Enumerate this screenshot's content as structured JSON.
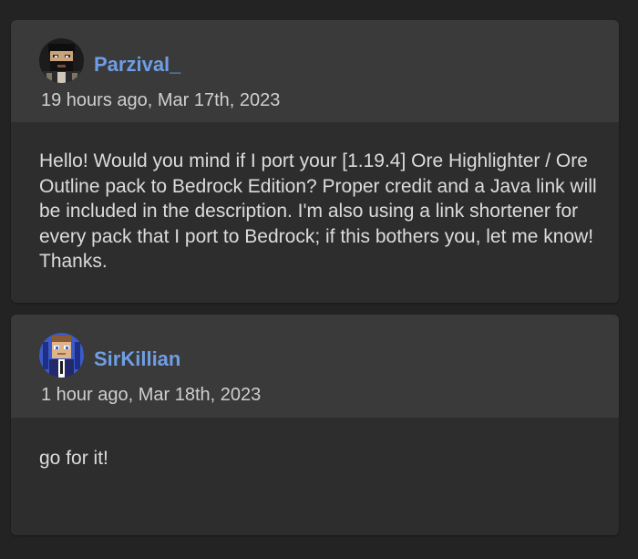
{
  "comments": [
    {
      "username": "Parzival_",
      "timestamp": "19 hours ago, Mar 17th, 2023",
      "text": "Hello! Would you mind if I port your [1.19.4] Ore Highlighter / Ore Outline pack to Bedrock Edition? Proper credit and a Java link will be included in the description. I'm also using a link shortener for every pack that I port to Bedrock; if this bothers you, let me know! Thanks.",
      "avatar_icon": "bearded-man-avatar-icon"
    },
    {
      "username": "SirKillian",
      "timestamp": "1 hour ago, Mar 18th, 2023",
      "text": "go for it!",
      "avatar_icon": "suit-man-avatar-icon"
    }
  ],
  "colors": {
    "page_background": "#232323",
    "card_header": "#3a3a3a",
    "card_body": "#2d2d2d",
    "username": "#6f9ee6",
    "timestamp": "#cfcfcf",
    "text": "#dcdcdc"
  }
}
